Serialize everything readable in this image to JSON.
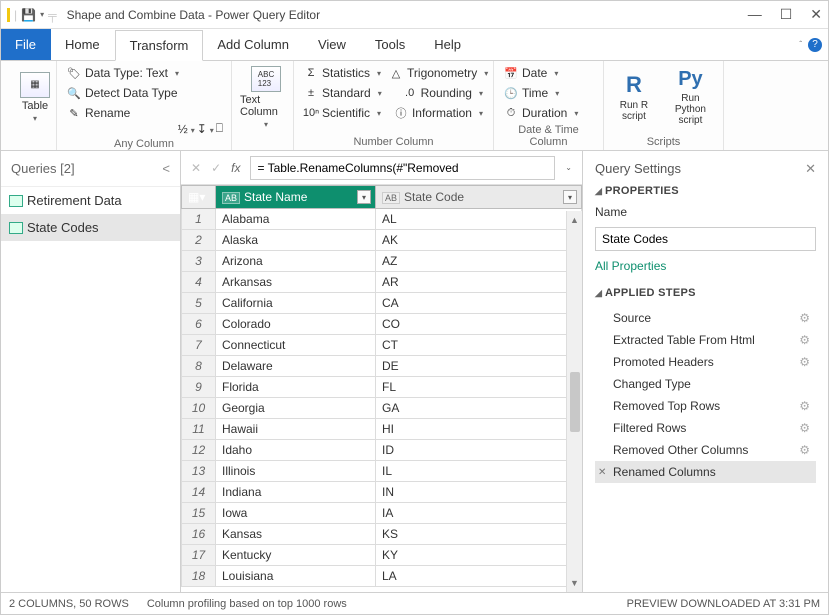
{
  "window": {
    "title": "Shape and Combine Data - Power Query Editor"
  },
  "menu": {
    "file": "File",
    "home": "Home",
    "transform": "Transform",
    "addcolumn": "Add Column",
    "view": "View",
    "tools": "Tools",
    "help": "Help"
  },
  "ribbon": {
    "table": "Table",
    "datatype": "Data Type: Text",
    "detect": "Detect Data Type",
    "rename": "Rename",
    "anycolumn": "Any Column",
    "textcolumn": "Text Column",
    "statistics": "Statistics",
    "standard": "Standard",
    "scientific": "Scientific",
    "trig": "Trigonometry",
    "rounding": "Rounding",
    "info": "Information",
    "numbercolumn": "Number Column",
    "date": "Date",
    "time": "Time",
    "duration": "Duration",
    "datetime": "Date & Time Column",
    "runr": "Run R script",
    "runpy": "Run Python script",
    "scripts": "Scripts"
  },
  "queries": {
    "header": "Queries [2]",
    "items": [
      "Retirement Data",
      "State Codes"
    ]
  },
  "formula": {
    "value": "= Table.RenameColumns(#\"Removed"
  },
  "columns": {
    "name": "State Name",
    "code": "State Code"
  },
  "rows": [
    {
      "n": 1,
      "name": "Alabama",
      "code": "AL"
    },
    {
      "n": 2,
      "name": "Alaska",
      "code": "AK"
    },
    {
      "n": 3,
      "name": "Arizona",
      "code": "AZ"
    },
    {
      "n": 4,
      "name": "Arkansas",
      "code": "AR"
    },
    {
      "n": 5,
      "name": "California",
      "code": "CA"
    },
    {
      "n": 6,
      "name": "Colorado",
      "code": "CO"
    },
    {
      "n": 7,
      "name": "Connecticut",
      "code": "CT"
    },
    {
      "n": 8,
      "name": "Delaware",
      "code": "DE"
    },
    {
      "n": 9,
      "name": "Florida",
      "code": "FL"
    },
    {
      "n": 10,
      "name": "Georgia",
      "code": "GA"
    },
    {
      "n": 11,
      "name": "Hawaii",
      "code": "HI"
    },
    {
      "n": 12,
      "name": "Idaho",
      "code": "ID"
    },
    {
      "n": 13,
      "name": "Illinois",
      "code": "IL"
    },
    {
      "n": 14,
      "name": "Indiana",
      "code": "IN"
    },
    {
      "n": 15,
      "name": "Iowa",
      "code": "IA"
    },
    {
      "n": 16,
      "name": "Kansas",
      "code": "KS"
    },
    {
      "n": 17,
      "name": "Kentucky",
      "code": "KY"
    },
    {
      "n": 18,
      "name": "Louisiana",
      "code": "LA"
    }
  ],
  "settings": {
    "title": "Query Settings",
    "properties": "PROPERTIES",
    "nameLabel": "Name",
    "nameValue": "State Codes",
    "allprops": "All Properties",
    "applied": "APPLIED STEPS",
    "steps": [
      {
        "label": "Source",
        "gear": true
      },
      {
        "label": "Extracted Table From Html",
        "gear": true
      },
      {
        "label": "Promoted Headers",
        "gear": true
      },
      {
        "label": "Changed Type",
        "gear": false
      },
      {
        "label": "Removed Top Rows",
        "gear": true
      },
      {
        "label": "Filtered Rows",
        "gear": true
      },
      {
        "label": "Removed Other Columns",
        "gear": true
      },
      {
        "label": "Renamed Columns",
        "gear": false,
        "sel": true
      }
    ]
  },
  "status": {
    "cols": "2 COLUMNS, 50 ROWS",
    "profiling": "Column profiling based on top 1000 rows",
    "preview": "PREVIEW DOWNLOADED AT 3:31 PM"
  }
}
